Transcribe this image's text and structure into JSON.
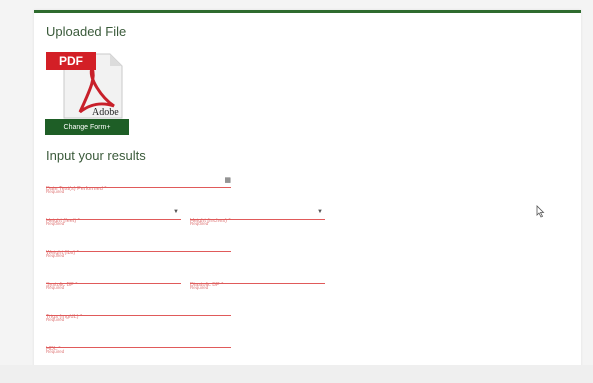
{
  "uploaded": {
    "title": "Uploaded File",
    "pdf_label": "PDF",
    "adobe_label": "Adobe",
    "change_button": "Change Form+"
  },
  "results": {
    "title": "Input your results",
    "required_text": "Required",
    "fields": {
      "date": "Date Test(s) Performed *",
      "height_feet": "Height (feet) *",
      "height_inches": "Height (inches) *",
      "weight": "Weight (lbs) *",
      "systolic": "Systolic BP *",
      "diastolic": "Diastolic BP *",
      "trigs": "Trigs (mg/dL) *",
      "hdl": "HDL *"
    }
  },
  "colors": {
    "accent": "#2e6b2e",
    "button": "#1e5e26",
    "required": "#e05a5a"
  }
}
